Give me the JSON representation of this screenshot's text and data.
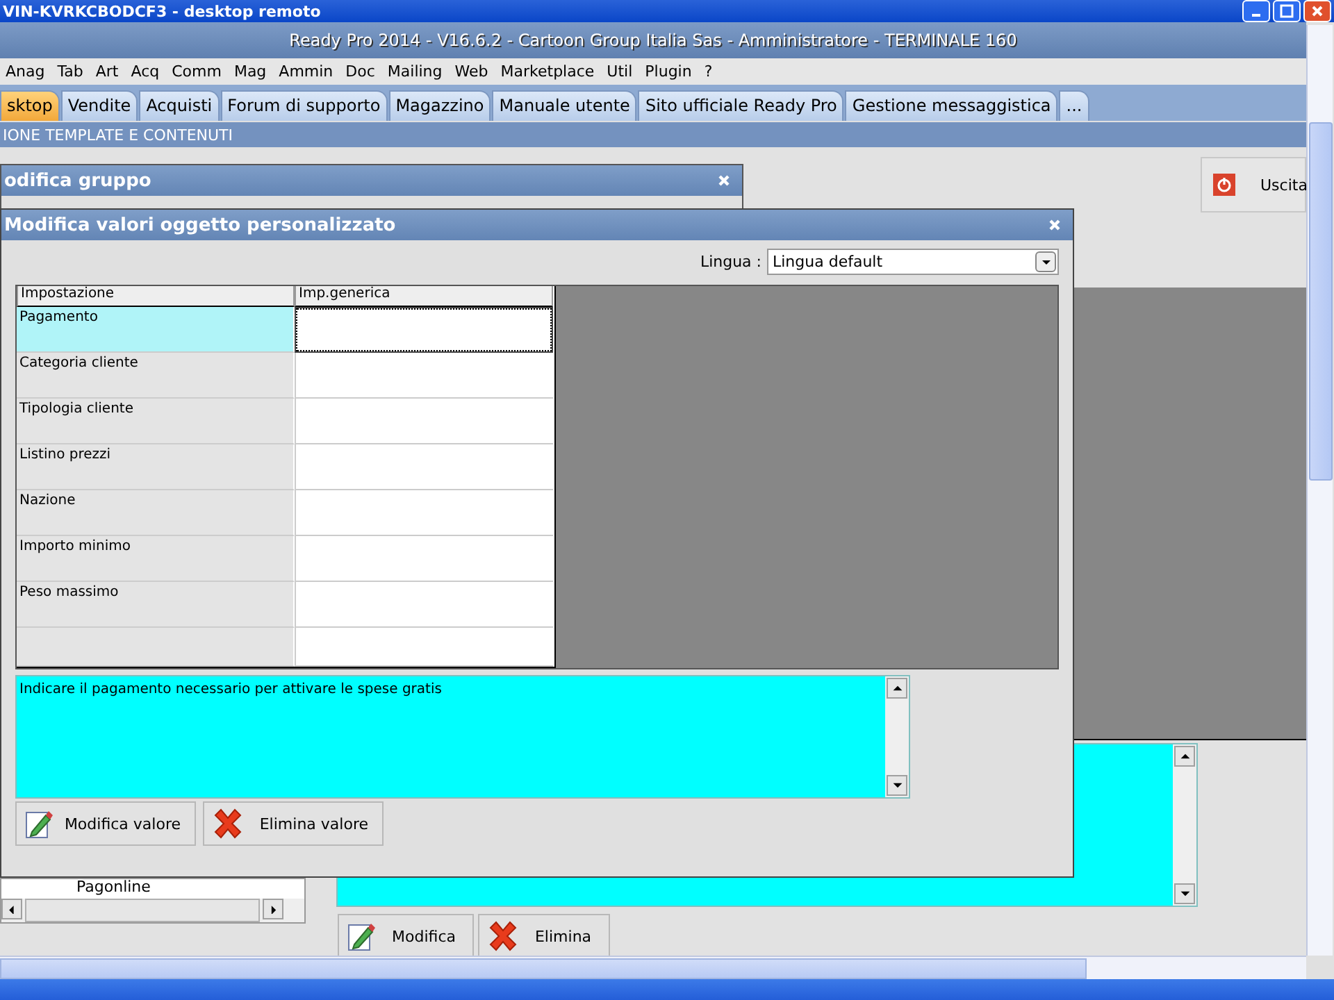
{
  "remote_window": {
    "title": "VIN-KVRKCBODCF3 - desktop remoto"
  },
  "app": {
    "title": "Ready Pro 2014 - V16.6.2 - Cartoon Group Italia Sas - Amministratore - TERMINALE 160"
  },
  "menu": [
    "Anag",
    "Tab",
    "Art",
    "Acq",
    "Comm",
    "Mag",
    "Ammin",
    "Doc",
    "Mailing",
    "Web",
    "Marketplace",
    "Util",
    "Plugin",
    "?"
  ],
  "tabs": [
    {
      "label": "sktop",
      "selected": true
    },
    {
      "label": "Vendite",
      "selected": false
    },
    {
      "label": "Acquisti",
      "selected": false
    },
    {
      "label": "Forum di supporto",
      "selected": false
    },
    {
      "label": "Magazzino",
      "selected": false
    },
    {
      "label": "Manuale utente",
      "selected": false
    },
    {
      "label": "Sito ufficiale Ready Pro",
      "selected": false
    },
    {
      "label": "Gestione messaggistica",
      "selected": false
    },
    {
      "label": "...",
      "selected": false
    }
  ],
  "section_title": "IONE TEMPLATE E CONTENUTI",
  "exit_button": "Uscita",
  "back_dialog": {
    "title": "odifica gruppo",
    "tree_items": [
      "Pagonline"
    ],
    "buttons": [
      {
        "label": "Modifica",
        "kind": "edit"
      },
      {
        "label": "Elimina",
        "kind": "delete"
      }
    ]
  },
  "dialog": {
    "title": "Modifica valori oggetto personalizzato",
    "language_label": "Lingua :",
    "language_value": "Lingua default",
    "columns": [
      "Impostazione",
      "Imp.generica"
    ],
    "rows": [
      {
        "name": "Pagamento",
        "selected": true
      },
      {
        "name": "Categoria cliente",
        "selected": false
      },
      {
        "name": "Tipologia cliente",
        "selected": false
      },
      {
        "name": "Listino prezzi",
        "selected": false
      },
      {
        "name": "Nazione",
        "selected": false
      },
      {
        "name": "Importo minimo",
        "selected": false
      },
      {
        "name": "Peso massimo",
        "selected": false
      }
    ],
    "description": "Indicare il pagamento necessario per attivare le spese gratis",
    "buttons": [
      {
        "label": "Modifica valore",
        "kind": "edit"
      },
      {
        "label": "Elimina valore",
        "kind": "delete"
      }
    ]
  }
}
